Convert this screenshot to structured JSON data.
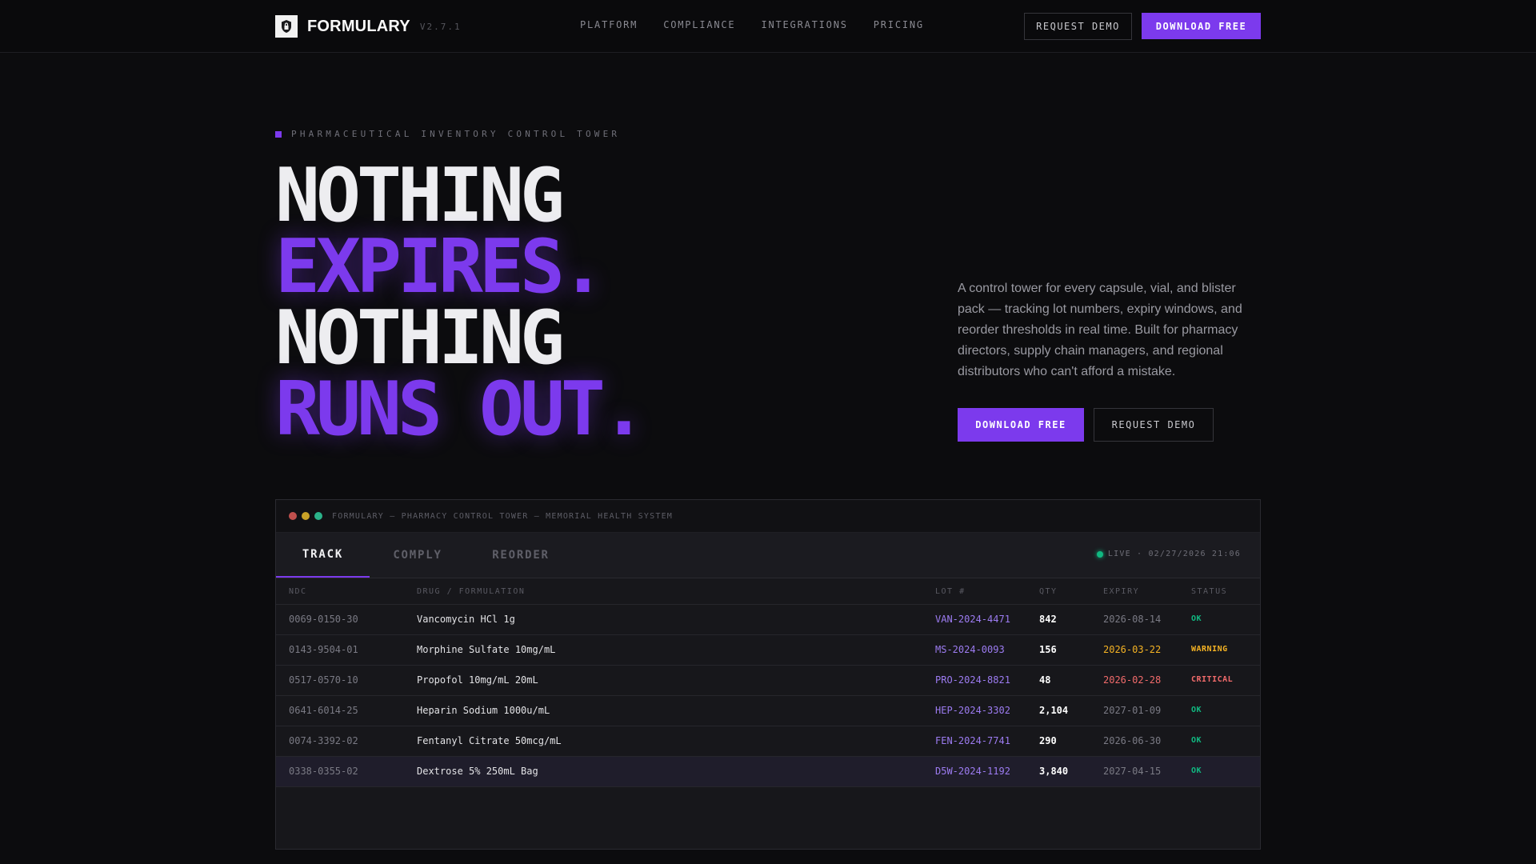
{
  "nav": {
    "brand": "FORMULARY",
    "version": "V2.7.1",
    "links": [
      "PLATFORM",
      "COMPLIANCE",
      "INTEGRATIONS",
      "PRICING"
    ],
    "request_demo": "REQUEST DEMO",
    "download_free": "DOWNLOAD FREE"
  },
  "hero": {
    "tagline": "PHARMACEUTICAL INVENTORY CONTROL TOWER",
    "headline": [
      "NOTHING",
      "EXPIRES.",
      "NOTHING",
      "RUNS OUT."
    ],
    "description": "A control tower for every capsule, vial, and blister pack — tracking lot numbers, expiry windows, and reorder thresholds in real time. Built for pharmacy directors, supply chain managers, and regional distributors who can't afford a mistake.",
    "download_free": "DOWNLOAD FREE",
    "request_demo": "REQUEST DEMO"
  },
  "dashboard": {
    "window_title": "FORMULARY — PHARMACY CONTROL TOWER — MEMORIAL HEALTH SYSTEM",
    "tabs": [
      "TRACK",
      "COMPLY",
      "REORDER"
    ],
    "active_tab": "TRACK",
    "live_status": "LIVE · 02/27/2026 21:06",
    "columns": [
      "NDC",
      "DRUG / FORMULATION",
      "LOT #",
      "QTY",
      "EXPIRY",
      "STATUS"
    ],
    "rows": [
      {
        "ndc": "0069-0150-30",
        "drug": "Vancomycin HCl 1g",
        "lot": "VAN-2024-4471",
        "qty": "842",
        "expiry": "2026-08-14",
        "status": "OK"
      },
      {
        "ndc": "0143-9504-01",
        "drug": "Morphine Sulfate 10mg/mL",
        "lot": "MS-2024-0093",
        "qty": "156",
        "expiry": "2026-03-22",
        "status": "WARNING"
      },
      {
        "ndc": "0517-0570-10",
        "drug": "Propofol 10mg/mL 20mL",
        "lot": "PRO-2024-8821",
        "qty": "48",
        "expiry": "2026-02-28",
        "status": "CRITICAL"
      },
      {
        "ndc": "0641-6014-25",
        "drug": "Heparin Sodium 1000u/mL",
        "lot": "HEP-2024-3302",
        "qty": "2,104",
        "expiry": "2027-01-09",
        "status": "OK"
      },
      {
        "ndc": "0074-3392-02",
        "drug": "Fentanyl Citrate 50mcg/mL",
        "lot": "FEN-2024-7741",
        "qty": "290",
        "expiry": "2026-06-30",
        "status": "OK"
      },
      {
        "ndc": "0338-0355-02",
        "drug": "Dextrose 5% 250mL Bag",
        "lot": "D5W-2024-1192",
        "qty": "3,840",
        "expiry": "2027-04-15",
        "status": "OK"
      }
    ]
  },
  "colors": {
    "accent": "#7c3aed",
    "ok": "#10b981",
    "warning": "#f5b324",
    "critical": "#f16b6b",
    "muted_date": "#7a7a84"
  },
  "icons": {
    "logo": "shield-lock-icon",
    "window_controls": [
      "close-dot",
      "minimize-dot",
      "maximize-dot"
    ],
    "live": "live-indicator-icon"
  }
}
